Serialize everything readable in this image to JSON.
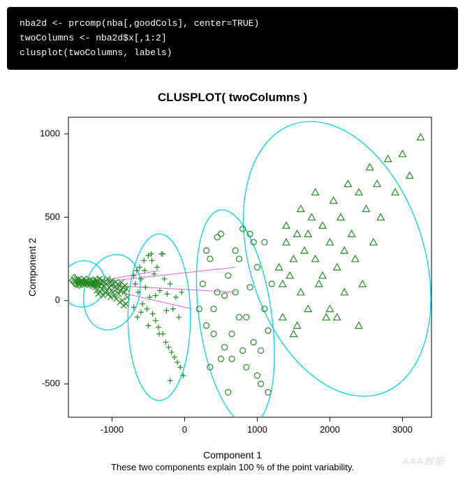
{
  "code": {
    "line1": "nba2d <- prcomp(nba[,goodCols], center=TRUE)",
    "line2": "twoColumns <- nba2d$x[,1:2]",
    "line3": "clusplot(twoColumns, labels)"
  },
  "chart_data": {
    "type": "scatter",
    "title": "CLUSPLOT( twoColumns )",
    "xlabel": "Component 1",
    "ylabel": "Component 2",
    "caption": "These two components explain 100 % of the point variability.",
    "xlim": [
      -1600,
      3400
    ],
    "ylim": [
      -700,
      1100
    ],
    "xticks": [
      -1000,
      0,
      1000,
      2000,
      3000
    ],
    "yticks": [
      -500,
      0,
      500,
      1000
    ],
    "clusters": [
      {
        "name": "cluster1-diamond",
        "marker": "diamond",
        "ellipse": {
          "cx": -1400,
          "cy": 100,
          "rx": 300,
          "ry": 140,
          "rot": -20
        },
        "points": [
          [
            -1550,
            120
          ],
          [
            -1530,
            110
          ],
          [
            -1520,
            140
          ],
          [
            -1510,
            100
          ],
          [
            -1500,
            130
          ],
          [
            -1490,
            95
          ],
          [
            -1480,
            115
          ],
          [
            -1470,
            105
          ],
          [
            -1460,
            125
          ],
          [
            -1450,
            90
          ],
          [
            -1440,
            110
          ],
          [
            -1430,
            100
          ],
          [
            -1420,
            130
          ],
          [
            -1410,
            95
          ],
          [
            -1400,
            115
          ],
          [
            -1390,
            105
          ],
          [
            -1380,
            120
          ],
          [
            -1370,
            100
          ],
          [
            -1360,
            110
          ],
          [
            -1350,
            130
          ],
          [
            -1340,
            95
          ],
          [
            -1330,
            105
          ],
          [
            -1320,
            115
          ],
          [
            -1310,
            100
          ],
          [
            -1300,
            120
          ],
          [
            -1290,
            90
          ],
          [
            -1280,
            110
          ],
          [
            -1270,
            100
          ],
          [
            -1260,
            125
          ],
          [
            -1250,
            95
          ],
          [
            -1240,
            105
          ],
          [
            -1230,
            115
          ],
          [
            -1220,
            100
          ],
          [
            -1210,
            110
          ],
          [
            -1200,
            130
          ],
          [
            -1190,
            95
          ]
        ]
      },
      {
        "name": "cluster2-cross",
        "marker": "cross",
        "ellipse": {
          "cx": -1000,
          "cy": 50,
          "rx": 380,
          "ry": 230,
          "rot": -15
        },
        "points": [
          [
            -1250,
            100
          ],
          [
            -1230,
            80
          ],
          [
            -1220,
            120
          ],
          [
            -1210,
            60
          ],
          [
            -1200,
            110
          ],
          [
            -1190,
            40
          ],
          [
            -1180,
            90
          ],
          [
            -1170,
            130
          ],
          [
            -1160,
            50
          ],
          [
            -1150,
            100
          ],
          [
            -1140,
            70
          ],
          [
            -1130,
            120
          ],
          [
            -1120,
            30
          ],
          [
            -1110,
            90
          ],
          [
            -1100,
            110
          ],
          [
            -1090,
            50
          ],
          [
            -1080,
            100
          ],
          [
            -1070,
            60
          ],
          [
            -1060,
            130
          ],
          [
            -1050,
            40
          ],
          [
            -1040,
            80
          ],
          [
            -1030,
            110
          ],
          [
            -1020,
            20
          ],
          [
            -1010,
            90
          ],
          [
            -1000,
            120
          ],
          [
            -990,
            50
          ],
          [
            -980,
            100
          ],
          [
            -970,
            30
          ],
          [
            -960,
            80
          ],
          [
            -950,
            110
          ],
          [
            -940,
            10
          ],
          [
            -930,
            70
          ],
          [
            -920,
            100
          ],
          [
            -910,
            40
          ],
          [
            -900,
            90
          ],
          [
            -890,
            -10
          ],
          [
            -880,
            60
          ],
          [
            -870,
            110
          ],
          [
            -860,
            0
          ],
          [
            -850,
            80
          ],
          [
            -840,
            -30
          ],
          [
            -830,
            50
          ],
          [
            -820,
            90
          ],
          [
            -810,
            -20
          ],
          [
            -800,
            70
          ],
          [
            -790,
            20
          ]
        ]
      },
      {
        "name": "cluster3-plus",
        "marker": "plus",
        "ellipse": {
          "cx": -350,
          "cy": -100,
          "rx": 430,
          "ry": 500,
          "rot": 0
        },
        "points": [
          [
            -700,
            150
          ],
          [
            -680,
            100
          ],
          [
            -660,
            180
          ],
          [
            -640,
            50
          ],
          [
            -620,
            200
          ],
          [
            -600,
            130
          ],
          [
            -580,
            -20
          ],
          [
            -560,
            240
          ],
          [
            -540,
            80
          ],
          [
            -520,
            -50
          ],
          [
            -500,
            270
          ],
          [
            -480,
            20
          ],
          [
            -460,
            280
          ],
          [
            -440,
            -80
          ],
          [
            -420,
            160
          ],
          [
            -400,
            -120
          ],
          [
            -380,
            200
          ],
          [
            -360,
            -160
          ],
          [
            -340,
            60
          ],
          [
            -320,
            280
          ],
          [
            -300,
            -200
          ],
          [
            -280,
            130
          ],
          [
            -260,
            -250
          ],
          [
            -240,
            40
          ],
          [
            -220,
            -280
          ],
          [
            -200,
            100
          ],
          [
            -180,
            -310
          ],
          [
            -160,
            -50
          ],
          [
            -140,
            -340
          ],
          [
            -120,
            20
          ],
          [
            -100,
            -370
          ],
          [
            -80,
            -100
          ],
          [
            -60,
            -400
          ],
          [
            -40,
            50
          ],
          [
            -20,
            -450
          ],
          [
            -700,
            -40
          ],
          [
            -650,
            -100
          ],
          [
            -600,
            -70
          ],
          [
            -550,
            180
          ],
          [
            -500,
            -150
          ],
          [
            -450,
            240
          ],
          [
            -400,
            30
          ],
          [
            -350,
            -200
          ],
          [
            -300,
            280
          ],
          [
            -250,
            -60
          ],
          [
            -200,
            -480
          ]
        ]
      },
      {
        "name": "cluster4-circle",
        "marker": "circle",
        "ellipse": {
          "cx": 700,
          "cy": -100,
          "rx": 500,
          "ry": 650,
          "rot": 8
        },
        "points": [
          [
            250,
            100
          ],
          [
            300,
            -150
          ],
          [
            350,
            250
          ],
          [
            400,
            -200
          ],
          [
            450,
            50
          ],
          [
            500,
            400
          ],
          [
            550,
            -280
          ],
          [
            600,
            150
          ],
          [
            650,
            -350
          ],
          [
            700,
            300
          ],
          [
            750,
            -100
          ],
          [
            800,
            430
          ],
          [
            850,
            -400
          ],
          [
            900,
            80
          ],
          [
            950,
            -250
          ],
          [
            1000,
            200
          ],
          [
            1050,
            -500
          ],
          [
            1100,
            350
          ],
          [
            1150,
            -180
          ],
          [
            1200,
            100
          ],
          [
            300,
            300
          ],
          [
            400,
            -50
          ],
          [
            500,
            -350
          ],
          [
            600,
            -550
          ],
          [
            700,
            50
          ],
          [
            800,
            -300
          ],
          [
            900,
            400
          ],
          [
            1000,
            -450
          ],
          [
            1100,
            -50
          ],
          [
            200,
            -50
          ],
          [
            350,
            -400
          ],
          [
            450,
            380
          ],
          [
            550,
            30
          ],
          [
            650,
            -200
          ],
          [
            750,
            250
          ],
          [
            850,
            -100
          ],
          [
            950,
            350
          ],
          [
            1050,
            -300
          ],
          [
            1150,
            -550
          ]
        ]
      },
      {
        "name": "cluster5-triangle",
        "marker": "triangle",
        "ellipse": {
          "cx": 2100,
          "cy": 250,
          "rx": 1200,
          "ry": 850,
          "rot": 18
        },
        "points": [
          [
            1300,
            200
          ],
          [
            1350,
            -100
          ],
          [
            1400,
            350
          ],
          [
            1450,
            150
          ],
          [
            1500,
            -200
          ],
          [
            1550,
            400
          ],
          [
            1600,
            50
          ],
          [
            1650,
            300
          ],
          [
            1700,
            -50
          ],
          [
            1750,
            500
          ],
          [
            1800,
            250
          ],
          [
            1850,
            100
          ],
          [
            1900,
            450
          ],
          [
            1950,
            -100
          ],
          [
            2000,
            350
          ],
          [
            2050,
            600
          ],
          [
            2100,
            200
          ],
          [
            2150,
            500
          ],
          [
            2200,
            50
          ],
          [
            2250,
            700
          ],
          [
            2300,
            400
          ],
          [
            2350,
            250
          ],
          [
            2400,
            650
          ],
          [
            2450,
            100
          ],
          [
            2500,
            550
          ],
          [
            2550,
            800
          ],
          [
            2600,
            350
          ],
          [
            2650,
            700
          ],
          [
            2700,
            500
          ],
          [
            2800,
            850
          ],
          [
            2900,
            650
          ],
          [
            3000,
            880
          ],
          [
            3100,
            750
          ],
          [
            3250,
            980
          ],
          [
            1400,
            450
          ],
          [
            1600,
            550
          ],
          [
            1800,
            650
          ],
          [
            2000,
            -50
          ],
          [
            2200,
            300
          ],
          [
            2400,
            -150
          ],
          [
            1500,
            250
          ],
          [
            1700,
            400
          ],
          [
            1900,
            150
          ],
          [
            2100,
            -100
          ],
          [
            1350,
            100
          ],
          [
            1550,
            -150
          ]
        ]
      }
    ],
    "connector_lines": [
      {
        "from": [
          -1400,
          100
        ],
        "to": [
          700,
          200
        ]
      },
      {
        "from": [
          -1400,
          100
        ],
        "to": [
          700,
          50
        ]
      },
      {
        "from": [
          -1400,
          100
        ],
        "to": [
          100,
          -50
        ]
      },
      {
        "from": [
          -1400,
          100
        ],
        "to": [
          -350,
          180
        ]
      }
    ]
  },
  "watermark": "AAA数据"
}
